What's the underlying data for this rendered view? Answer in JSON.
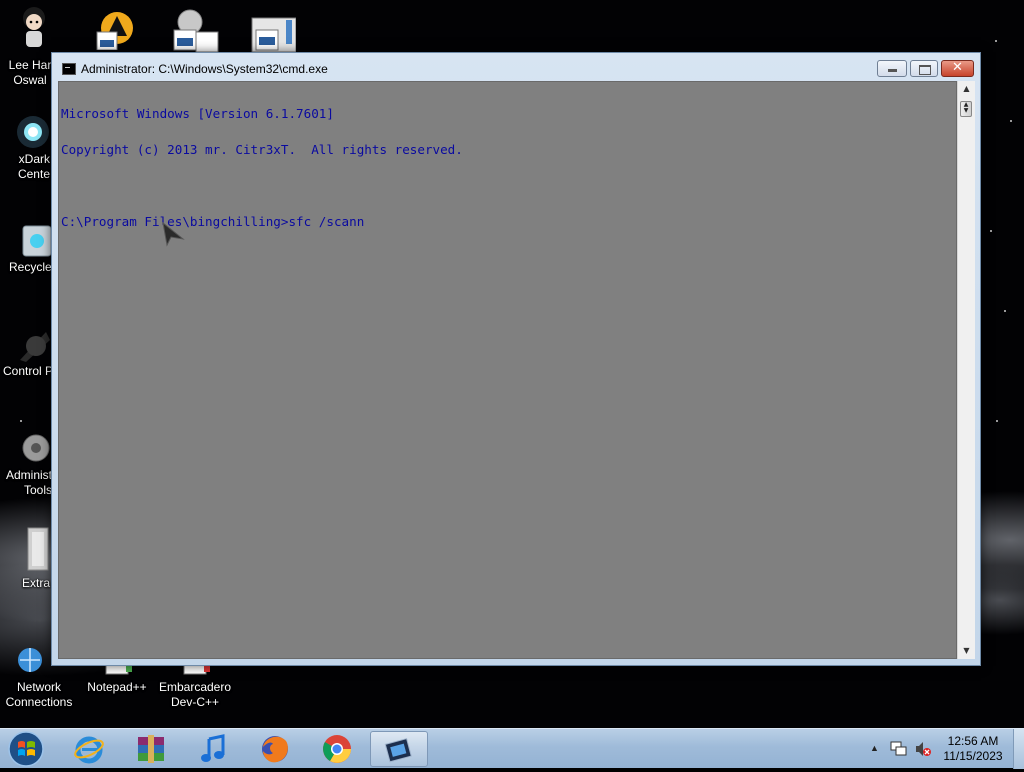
{
  "desktop": {
    "icons": [
      {
        "id": "lee-harvey-oswald",
        "label": "Lee Har\nOswal"
      },
      {
        "id": "xdark-center",
        "label": "xDark\nCente"
      },
      {
        "id": "recycle-bin",
        "label": "Recycle"
      },
      {
        "id": "control-panel",
        "label": "Control P"
      },
      {
        "id": "admin-tools",
        "label": "Administ\nTools"
      },
      {
        "id": "extra",
        "label": "Extra"
      },
      {
        "id": "network-connections",
        "label": "Network\nConnections"
      },
      {
        "id": "notepad-plus-plus",
        "label": "Notepad++"
      },
      {
        "id": "embarcadero-dev-cpp",
        "label": "Embarcadero\nDev-C++"
      }
    ]
  },
  "cmd_window": {
    "title": "Administrator: C:\\Windows\\System32\\cmd.exe",
    "close_glyph": "✕",
    "console_lines": [
      "Microsoft Windows [Version 6.1.7601]",
      "Copyright (c) 2013 mr. Citr3xT.  All rights reserved.",
      "",
      "C:\\Program Files\\bingchilling>sfc /scann"
    ],
    "text_color": "#0a0aa0",
    "background_color": "#808080"
  },
  "taskbar": {
    "pinned": [
      "start-orb",
      "internet-explorer",
      "winrar",
      "itunes",
      "firefox",
      "chrome",
      "cmd"
    ],
    "active": "cmd",
    "tray": {
      "time": "12:56 AM",
      "date": "11/15/2023",
      "icons": [
        "show-hidden-icons",
        "network-icon",
        "volume-muted-icon"
      ],
      "show_hidden_glyph": "▲"
    }
  }
}
